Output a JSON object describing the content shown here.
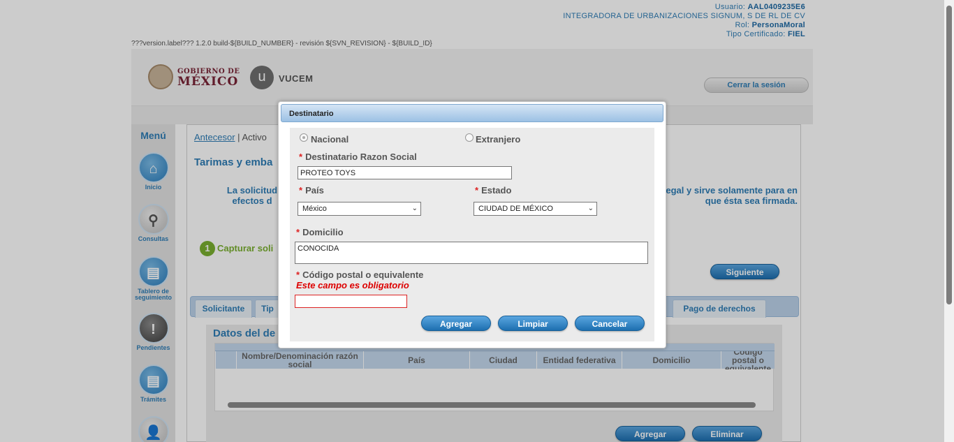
{
  "user": {
    "usuario_label": "Usuario:",
    "usuario": "AAL0409235E6",
    "company": "INTEGRADORA DE URBANIZACIONES SIGNUM, S DE RL DE CV",
    "rol_label": "Rol:",
    "rol": "PersonaMoral",
    "cert_label": "Tipo Certificado:",
    "cert": "FIEL"
  },
  "version": "???version.label??? 1.2.0 build-${BUILD_NUMBER} - revisión ${SVN_REVISION} - ${BUILD_ID}",
  "header": {
    "gob_line1": "GOBIERNO DE",
    "gob_line2": "MÉXICO",
    "vucem_letter": "u",
    "vucem": "VUCEM",
    "logout": "Cerrar la sesión"
  },
  "sidebar": {
    "title": "Menú",
    "items": [
      {
        "label": "Inicio",
        "icon": "home-icon"
      },
      {
        "label": "Consultas",
        "icon": "search-icon"
      },
      {
        "label": "Tablero de seguimiento",
        "icon": "document-icon"
      },
      {
        "label": "Pendientes",
        "icon": "alert-icon"
      },
      {
        "label": "Trámites",
        "icon": "document-icon"
      },
      {
        "label": "",
        "icon": "user-icon"
      }
    ]
  },
  "main": {
    "crumb_prev": "Antecesor",
    "crumb_sep": "|",
    "crumb_cur": "Activo",
    "title": "Tarimas y emba",
    "notice_left": "La solicitud efectos d",
    "notice_right": "egal y sirve solamente para en que ésta sea firmada.",
    "step_num": "1",
    "step_label": "Capturar soli",
    "next": "Siguiente",
    "tabs": [
      "Solicitante",
      "Tip",
      "Pago de derechos"
    ],
    "panel_title": "Datos del de",
    "columns": [
      "Nombre/Denominación razón social",
      "País",
      "Ciudad",
      "Entidad federativa",
      "Domicilio",
      "Código postal o equivalente"
    ],
    "add": "Agregar",
    "delete": "Eliminar"
  },
  "dialog": {
    "title": "Destinatario",
    "radio_nacional": "Nacional",
    "radio_extranjero": "Extranjero",
    "razon_label": "Destinatario Razon Social",
    "razon_value": "PROTEO TOYS",
    "pais_label": "País",
    "pais_value": "México",
    "estado_label": "Estado",
    "estado_value": "CIUDAD DE MÉXICO",
    "domicilio_label": "Domicilio",
    "domicilio_value": "CONOCIDA",
    "cp_label": "Código postal o equivalente",
    "cp_error": "Este campo es obligatorio",
    "cp_value": "",
    "required_mark": "*",
    "btn_add": "Agregar",
    "btn_clear": "Limpiar",
    "btn_cancel": "Cancelar"
  }
}
